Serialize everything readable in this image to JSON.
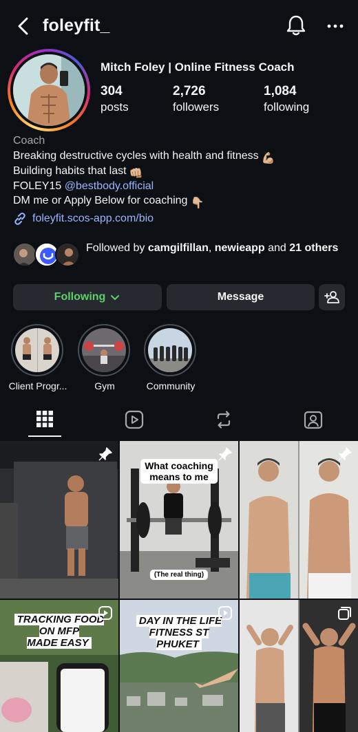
{
  "header": {
    "username": "foleyfit_"
  },
  "profile": {
    "display_name": "Mitch Foley | Online Fitness Coach",
    "stats": [
      {
        "value": "304",
        "label": "posts"
      },
      {
        "value": "2,726",
        "label": "followers"
      },
      {
        "value": "1,084",
        "label": "following"
      }
    ],
    "category": "Coach",
    "bio": {
      "line1": "Breaking destructive cycles with health and fitness",
      "line1_emoji": "💪🏼",
      "line2": "Building habits that last",
      "line2_emoji": "👊🏼",
      "line3_prefix": "FOLEY15 ",
      "line3_mention": "@bestbody.official",
      "line4": "DM me or Apply Below for coaching",
      "line4_emoji": "👇🏼"
    },
    "link": "foleyfit.scos-app.com/bio",
    "followed_by": {
      "prefix": "Followed by ",
      "user1": "camgilfillan",
      "sep": ", ",
      "user2": "newieapp",
      "mid": " and ",
      "count": "21",
      "suffix": " others"
    }
  },
  "actions": {
    "following_label": "Following",
    "message_label": "Message"
  },
  "highlights": [
    {
      "label": "Client Progr..."
    },
    {
      "label": "Gym"
    },
    {
      "label": "Community"
    }
  ],
  "posts": {
    "post2_caption_top": "What coaching\nmeans to me",
    "post2_caption_bottom": "(The real thing)",
    "post4_caption": "TRACKING FOOD\nON MFP\nMADE EASY",
    "post5_caption": "DAY IN THE LIFE\nFITNESS ST\nPHUKET"
  },
  "colors": {
    "background": "#0c1014",
    "button_bg": "#262a30",
    "following_green": "#5fd06a",
    "link_blue": "#9ab4ff",
    "muted": "#a8a8a8"
  },
  "icons": [
    "back-icon",
    "bell-icon",
    "more-icon",
    "link-icon",
    "chevron-down-icon",
    "add-user-icon",
    "grid-icon",
    "reels-icon",
    "reposts-icon",
    "tagged-icon",
    "pin-icon",
    "reel-badge-icon",
    "carousel-icon"
  ]
}
